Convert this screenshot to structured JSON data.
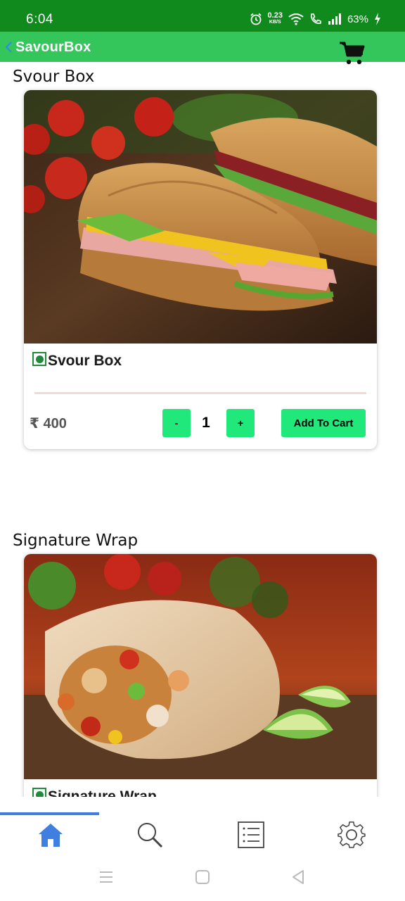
{
  "status_bar": {
    "time": "6:04",
    "net_speed_value": "0.23",
    "net_speed_unit": "KB/S",
    "battery": "63%",
    "icons": [
      "alarm-icon",
      "wifi-icon",
      "call-icon",
      "signal-icon",
      "battery-charging-icon"
    ]
  },
  "app_bar": {
    "title": "SavourBox",
    "back_icon": "chevron-left-icon",
    "cart_icon": "cart-icon",
    "color": "#34c65b"
  },
  "products": [
    {
      "section_title": "Svour Box",
      "name": "Svour Box",
      "price": "₹ 400",
      "quantity": "1",
      "minus_label": "-",
      "plus_label": "+",
      "add_to_cart_label": "Add To Cart",
      "veg": true
    },
    {
      "section_title": "Signature Wrap",
      "name": "Signature Wrap",
      "veg": true
    }
  ],
  "bottom_nav": {
    "items": [
      "home-icon",
      "search-icon",
      "list-icon",
      "settings-icon"
    ],
    "active_index": 0,
    "active_color": "#3f7fe0"
  },
  "system_nav": [
    "recent-apps-icon",
    "home-button-icon",
    "back-button-icon"
  ],
  "colors": {
    "status_bar": "#108a1c",
    "button": "#21e87a",
    "veg_mark": "#1e8a3a"
  }
}
